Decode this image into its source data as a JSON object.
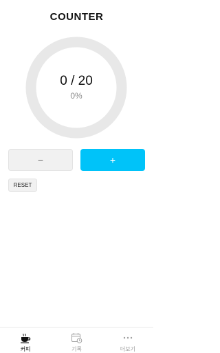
{
  "header": {
    "title": "COUNTER"
  },
  "counter": {
    "current": 0,
    "goal": 20,
    "display": "0 / 20",
    "percent_text": "0%",
    "progress": 0
  },
  "controls": {
    "minus_label": "−",
    "plus_label": "+",
    "reset_label": "RESET"
  },
  "colors": {
    "accent": "#00c3f9",
    "ring_track": "#e8e8e8",
    "muted_text": "#8c8c8c"
  },
  "tabbar": {
    "items": [
      {
        "label": "커피",
        "icon": "coffee-cup-icon",
        "active": true
      },
      {
        "label": "기록",
        "icon": "calendar-clock-icon",
        "active": false
      },
      {
        "label": "더보기",
        "icon": "more-dots-icon",
        "active": false
      }
    ]
  }
}
